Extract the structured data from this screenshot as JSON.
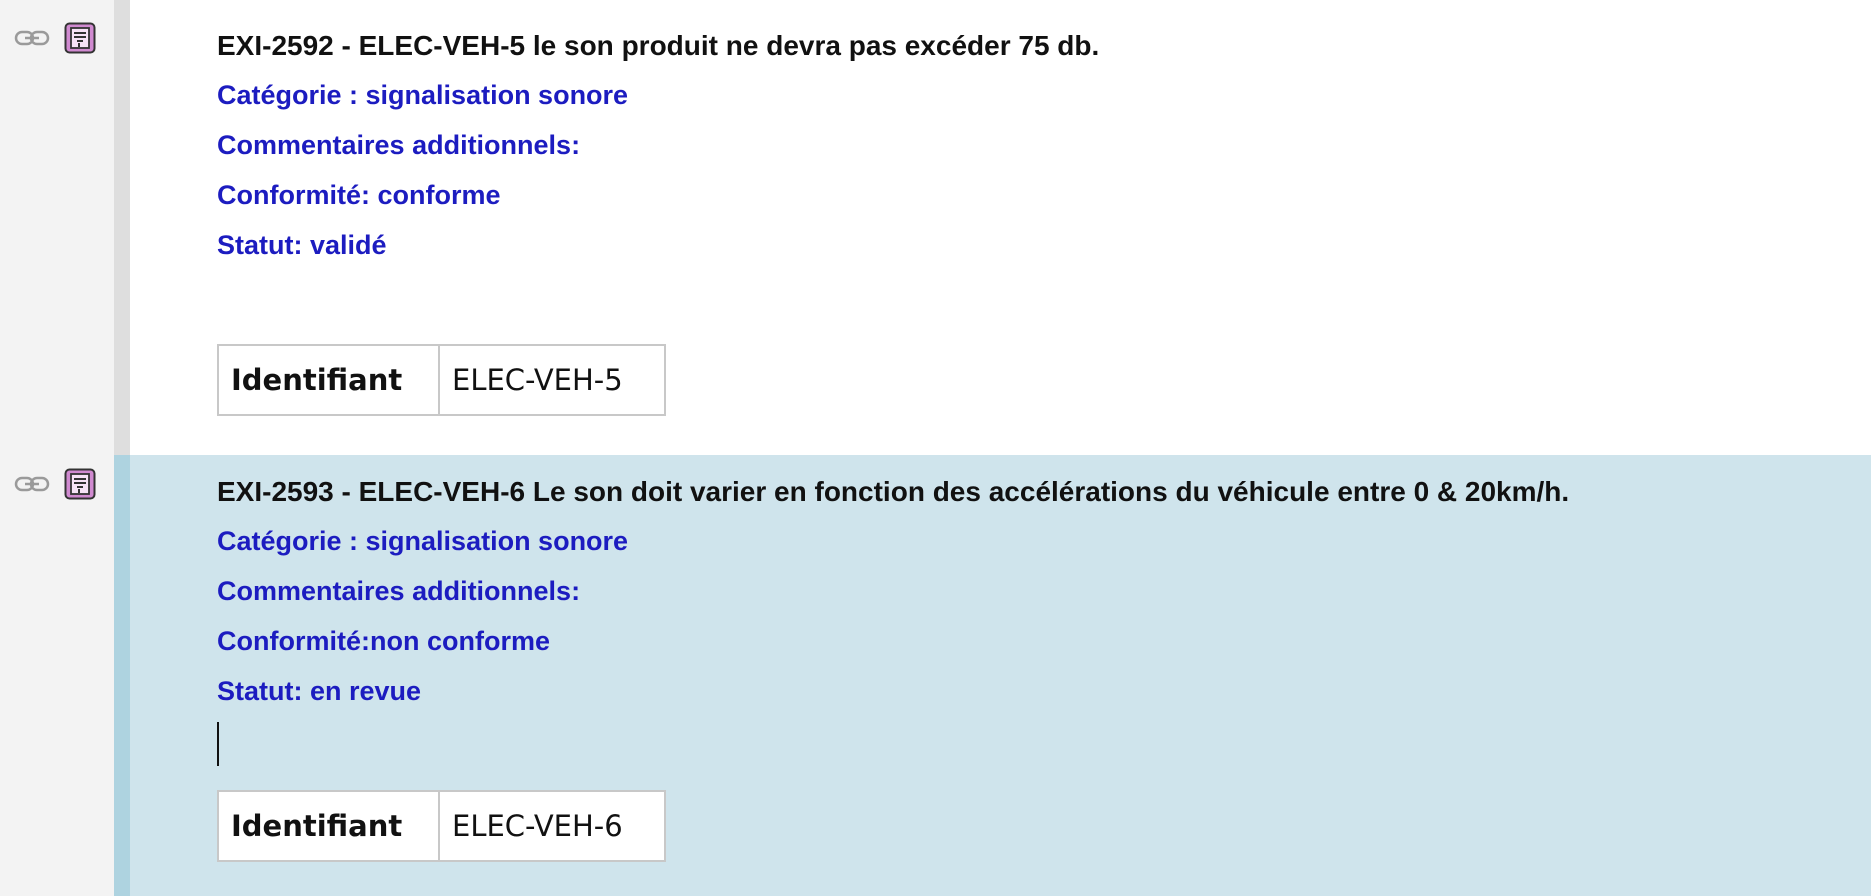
{
  "requirements": [
    {
      "title": "EXI-2592 - ELEC-VEH-5 le son produit ne devra pas excéder 75 db.",
      "categorie": "Catégorie : signalisation sonore",
      "commentaires": "Commentaires additionnels:",
      "conformite": "Conformité: conforme",
      "statut": "Statut: validé",
      "table_label": "Identifiant",
      "table_value": "ELEC-VEH-5",
      "icons": [
        "link-icon",
        "requirement-icon"
      ]
    },
    {
      "title": "EXI-2593 - ELEC-VEH-6 Le son doit varier en fonction des accélérations du véhicule entre 0 & 20km/h.",
      "categorie": "Catégorie : signalisation sonore",
      "commentaires": "Commentaires additionnels:",
      "conformite": "Conformité:non conforme",
      "statut": "Statut: en revue",
      "table_label": "Identifiant",
      "table_value": "ELEC-VEH-6",
      "icons": [
        "link-icon",
        "requirement-icon"
      ]
    }
  ],
  "colors": {
    "meta_text": "#1c1cc0",
    "selected_block_bg": "#cfe4ec",
    "gutter_bg": "#f3f3f3",
    "requirement_icon": "#c878c8"
  }
}
